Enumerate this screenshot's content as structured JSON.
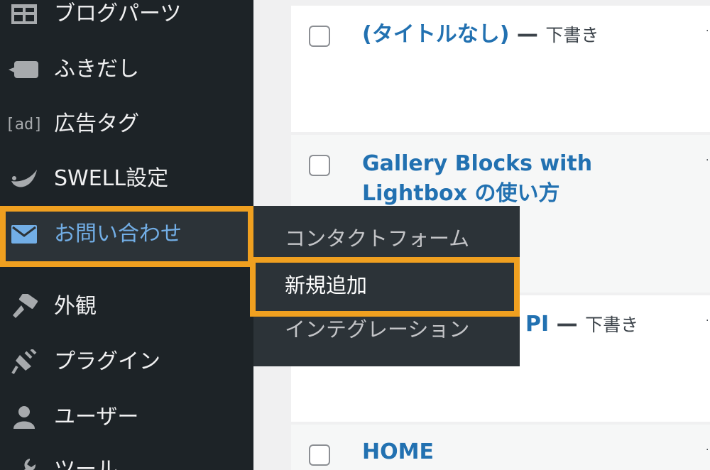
{
  "sidebar": {
    "items": [
      {
        "label": "ブログパーツ",
        "icon": "grid-icon"
      },
      {
        "label": "ふきだし",
        "icon": "speech-bubble-icon"
      },
      {
        "label": "広告タグ",
        "icon": "ad-icon",
        "icon_text": "[ad]"
      },
      {
        "label": "SWELL設定",
        "icon": "swell-leaf-icon"
      },
      {
        "label": "お問い合わせ",
        "icon": "mail-icon",
        "active": true
      },
      {
        "label": "外観",
        "icon": "paintbrush-icon"
      },
      {
        "label": "プラグイン",
        "icon": "plugin-icon"
      },
      {
        "label": "ユーザー",
        "icon": "user-icon"
      },
      {
        "label": "ツール",
        "icon": "wrench-icon"
      }
    ]
  },
  "flyout": {
    "items": [
      {
        "label": "コンタクトフォーム"
      },
      {
        "label": "新規追加",
        "current": true
      },
      {
        "label": "インテグレーション"
      }
    ]
  },
  "posts": [
    {
      "title": "(タイトルなし)",
      "dash": "—",
      "state": "下書き"
    },
    {
      "title": "Gallery Blocks with Lightbox の使い方"
    },
    {
      "title": "PI",
      "dash": "—",
      "state": "下書き"
    },
    {
      "title": "HOME"
    }
  ],
  "colors": {
    "sidebar_bg": "#1d2327",
    "flyout_bg": "#2c3338",
    "link": "#2271b1",
    "active_label": "#72aee6",
    "highlight": "#f0a020"
  }
}
